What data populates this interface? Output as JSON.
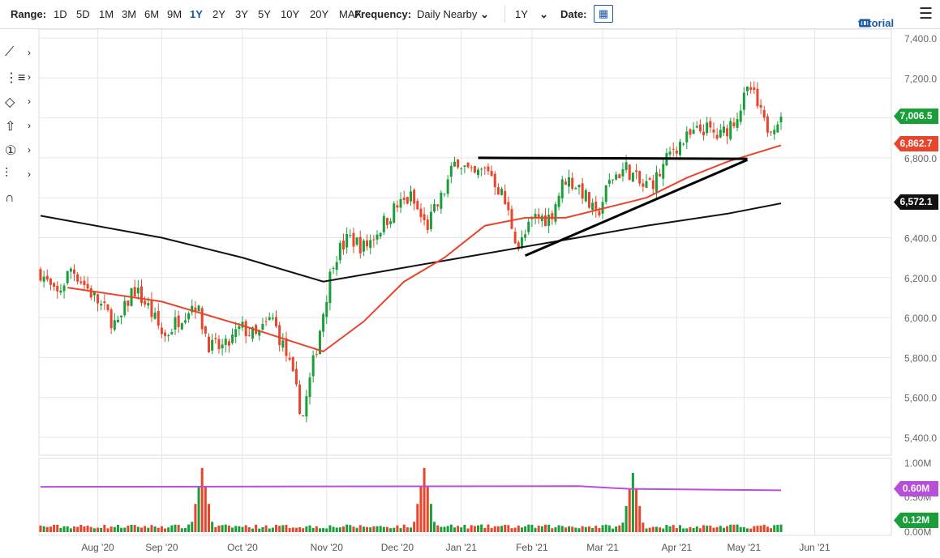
{
  "toolbar": {
    "range_label": "Range:",
    "ranges": [
      "1D",
      "5D",
      "1M",
      "3M",
      "6M",
      "9M",
      "1Y",
      "2Y",
      "3Y",
      "5Y",
      "10Y",
      "20Y",
      "MAX"
    ],
    "selected_range": "1Y",
    "frequency_label": "Frequency:",
    "frequency_value": "Daily Nearby",
    "period_value": "1Y",
    "date_label": "Date:",
    "tutorial_label": "tutorial"
  },
  "left_tools": [
    "line-tool",
    "fib-tool",
    "shape-tool",
    "arrow-tool",
    "annotation-tool",
    "measure-tool",
    "magnet-tool"
  ],
  "colors": {
    "up": "#1a9e3a",
    "down": "#e8452c",
    "ma50": "#e8452c",
    "ma200": "#111111",
    "vol_ma": "#b84fd8",
    "accent": "#1a5aa8"
  },
  "chart_data": {
    "type": "candlestick",
    "x_unit": "trading-day index (0 = 20 Jul 2020)",
    "xlabels": [
      {
        "label": "Aug '20",
        "i": 17
      },
      {
        "label": "Sep '20",
        "i": 36
      },
      {
        "label": "Oct '20",
        "i": 60
      },
      {
        "label": "Nov '20",
        "i": 85
      },
      {
        "label": "Dec '20",
        "i": 106
      },
      {
        "label": "Jan '21",
        "i": 125
      },
      {
        "label": "Feb '21",
        "i": 146
      },
      {
        "label": "Mar '21",
        "i": 167
      },
      {
        "label": "Apr '21",
        "i": 189
      },
      {
        "label": "May '21",
        "i": 209
      },
      {
        "label": "Jun '21",
        "i": 230
      }
    ],
    "y_ticks": [
      7400,
      7200,
      7000,
      6800,
      6600,
      6400,
      6200,
      6000,
      5800,
      5600,
      5400
    ],
    "y_tick_labels": [
      "7,400.0",
      "7,200.0",
      "7,000.0",
      "6,800.0",
      "6,600.0",
      "6,400.0",
      "6,200.0",
      "6,000.0",
      "5,800.0",
      "5,600.0",
      "5,400.0"
    ],
    "ylim": [
      5330,
      7410
    ],
    "weekly_closes": [
      6230,
      6100,
      6250,
      6150,
      6050,
      5950,
      6150,
      6050,
      5900,
      6000,
      6080,
      5850,
      5850,
      5950,
      5900,
      6000,
      5800,
      5500,
      5900,
      6300,
      6400,
      6350,
      6450,
      6550,
      6600,
      6450,
      6600,
      6800,
      6700,
      6750,
      6600,
      6350,
      6500,
      6500,
      6700,
      6650,
      6500,
      6700,
      6750,
      6650,
      6700,
      6850,
      6900,
      6950,
      6900,
      7000,
      7150,
      6950,
      7006.5
    ],
    "ma50": [
      [
        8,
        6150
      ],
      [
        36,
        6080
      ],
      [
        60,
        5960
      ],
      [
        84,
        5830
      ],
      [
        96,
        5980
      ],
      [
        108,
        6180
      ],
      [
        120,
        6300
      ],
      [
        132,
        6460
      ],
      [
        144,
        6500
      ],
      [
        156,
        6500
      ],
      [
        180,
        6600
      ],
      [
        192,
        6700
      ],
      [
        204,
        6780
      ],
      [
        220,
        6862.7
      ]
    ],
    "ma200": [
      [
        0,
        6510
      ],
      [
        36,
        6400
      ],
      [
        60,
        6300
      ],
      [
        84,
        6180
      ],
      [
        108,
        6250
      ],
      [
        132,
        6320
      ],
      [
        156,
        6390
      ],
      [
        180,
        6460
      ],
      [
        204,
        6520
      ],
      [
        220,
        6572.1
      ]
    ],
    "trendlines": [
      {
        "from": [
          130,
          6800
        ],
        "to": [
          210,
          6795
        ]
      },
      {
        "from": [
          144,
          6310
        ],
        "to": [
          210,
          6790
        ]
      }
    ],
    "last": {
      "price": "7,006.5",
      "ma50": "6,862.7",
      "ma200": "6,572.1"
    },
    "volume": {
      "ticks": [
        "1.00M",
        "0.50M",
        "0.00M"
      ],
      "ma_level": "0.60M",
      "last": "0.12M",
      "ylim": [
        0,
        1.0
      ],
      "ma": [
        [
          0,
          0.65
        ],
        [
          160,
          0.66
        ],
        [
          175,
          0.62
        ],
        [
          220,
          0.6
        ]
      ],
      "spikes": [
        [
          48,
          0.92
        ],
        [
          114,
          0.92
        ],
        [
          176,
          0.85
        ]
      ]
    }
  }
}
